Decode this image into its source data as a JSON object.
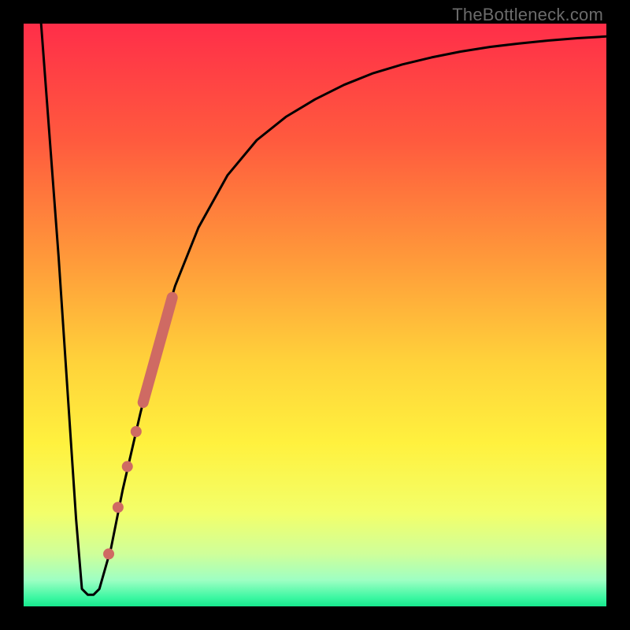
{
  "watermark": "TheBottleneck.com",
  "chart_data": {
    "type": "line",
    "title": "",
    "xlabel": "",
    "ylabel": "",
    "xlim": [
      0,
      100
    ],
    "ylim": [
      0,
      100
    ],
    "grid": false,
    "series": [
      {
        "name": "bottleneck-curve",
        "x": [
          3,
          6,
          9,
          10,
          11,
          12,
          13,
          15,
          17,
          20,
          23,
          26,
          30,
          35,
          40,
          45,
          50,
          55,
          60,
          65,
          70,
          75,
          80,
          85,
          90,
          95,
          100
        ],
        "y": [
          100,
          60,
          15,
          3,
          2,
          2,
          3,
          10,
          20,
          33,
          45,
          55,
          65,
          74,
          80,
          84,
          87,
          89.5,
          91.5,
          93,
          94.2,
          95.2,
          96,
          96.6,
          97.1,
          97.5,
          97.8
        ]
      }
    ],
    "markers": [
      {
        "name": "highlight-segment",
        "type": "thick-line",
        "color": "#cf6a63",
        "x": [
          20.5,
          25.5
        ],
        "y": [
          35,
          53
        ]
      },
      {
        "name": "dot-1",
        "type": "dot",
        "color": "#cf6a63",
        "x": 19.3,
        "y": 30
      },
      {
        "name": "dot-2",
        "type": "dot",
        "color": "#cf6a63",
        "x": 17.8,
        "y": 24
      },
      {
        "name": "dot-3",
        "type": "dot",
        "color": "#cf6a63",
        "x": 16.2,
        "y": 17
      },
      {
        "name": "dot-4",
        "type": "dot",
        "color": "#cf6a63",
        "x": 14.6,
        "y": 9
      }
    ],
    "background_gradient": [
      {
        "stop": 0.0,
        "color": "#ff2e49"
      },
      {
        "stop": 0.2,
        "color": "#ff5a3e"
      },
      {
        "stop": 0.4,
        "color": "#ff983a"
      },
      {
        "stop": 0.58,
        "color": "#ffd23a"
      },
      {
        "stop": 0.72,
        "color": "#fff13e"
      },
      {
        "stop": 0.84,
        "color": "#f3ff6a"
      },
      {
        "stop": 0.91,
        "color": "#cfff9a"
      },
      {
        "stop": 0.955,
        "color": "#9effc3"
      },
      {
        "stop": 0.985,
        "color": "#3cf7a2"
      },
      {
        "stop": 1.0,
        "color": "#17e88e"
      }
    ]
  }
}
